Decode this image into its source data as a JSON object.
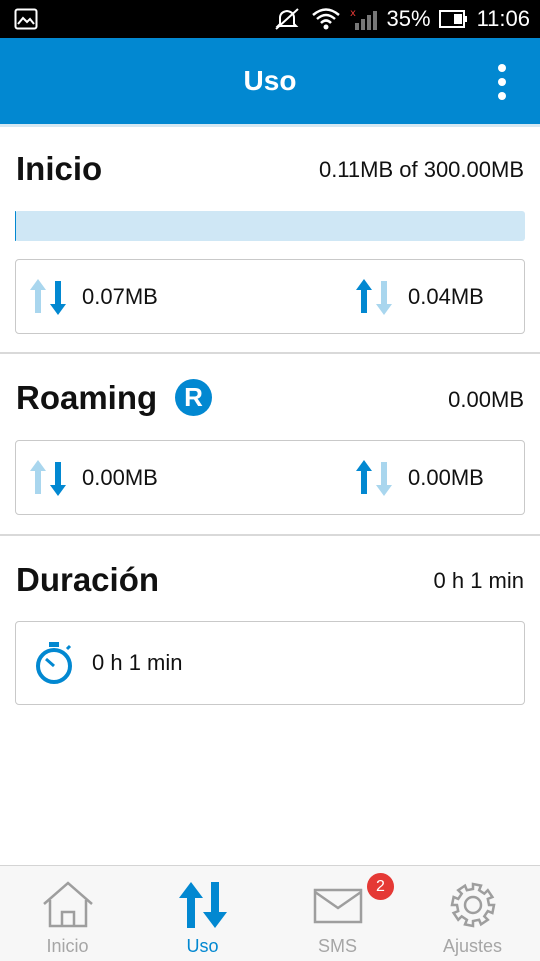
{
  "status_bar": {
    "battery": "35%",
    "time": "11:06"
  },
  "app_bar": {
    "title": "Uso"
  },
  "inicio": {
    "title": "Inicio",
    "usage": "0.11MB of 300.00MB",
    "progress_fraction": 0.000367,
    "download": "0.07MB",
    "upload": "0.04MB"
  },
  "roaming": {
    "title": "Roaming",
    "badge": "R",
    "total": "0.00MB",
    "download": "0.00MB",
    "upload": "0.00MB"
  },
  "duracion": {
    "title": "Duración",
    "total": "0 h 1 min",
    "timer": "0 h 1 min"
  },
  "bottom_nav": {
    "items": [
      {
        "label": "Inicio",
        "icon": "home-icon",
        "active": false
      },
      {
        "label": "Uso",
        "icon": "transfer-arrows-icon",
        "active": true
      },
      {
        "label": "SMS",
        "icon": "envelope-icon",
        "active": false,
        "badge": "2"
      },
      {
        "label": "Ajustes",
        "icon": "gear-icon",
        "active": false
      }
    ]
  },
  "colors": {
    "accent": "#0288d1",
    "accent_light": "#a9d6ee",
    "badge_red": "#e53935"
  }
}
